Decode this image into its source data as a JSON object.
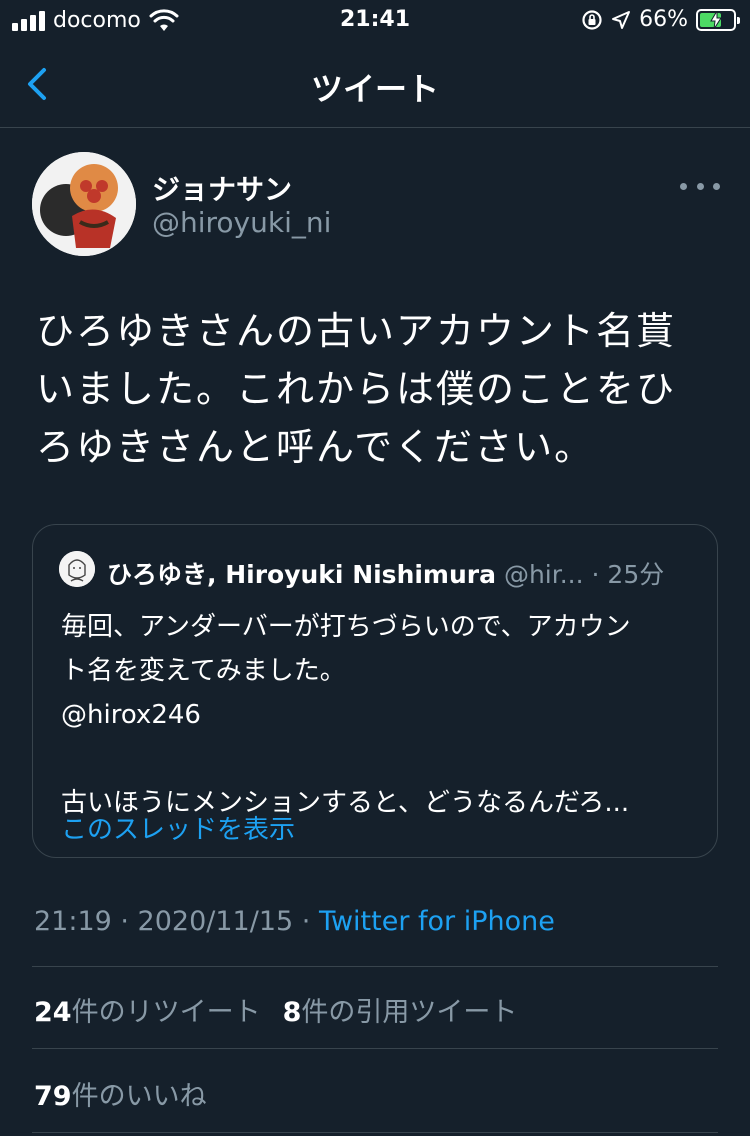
{
  "status_bar": {
    "carrier": "docomo",
    "time": "21:41",
    "battery_percent": "66%",
    "battery_level": 0.66
  },
  "nav": {
    "title": "ツイート"
  },
  "tweet": {
    "display_name": "ジョナサン",
    "handle": "@hiroyuki_ni",
    "text_lines": [
      "ひろゆきさんの古いアカウント名貰",
      "いました。これからは僕のことをひ",
      "ろゆきさんと呼んでください。"
    ],
    "timestamp": "21:19 · 2020/11/15 · ",
    "source": "Twitter for iPhone"
  },
  "quote": {
    "name": "ひろゆき, Hiroyuki Nishimura",
    "handle_truncated": "@hir...",
    "time_ago": "· 25分",
    "lines": [
      "毎回、アンダーバーが打ちづらいので、アカウン",
      "ト名を変えてみました。",
      "@hirox246",
      "",
      "古いほうにメンションすると、どうなるんだろ..."
    ],
    "thread_link": "このスレッドを表示"
  },
  "stats": {
    "retweets_count": "24",
    "retweets_label": "件のリツイート",
    "quotes_count": "8",
    "quotes_label": "件の引用ツイート",
    "likes_count": "79",
    "likes_label": "件のいいね"
  },
  "colors": {
    "background": "#15202b",
    "accent": "#1da1f2",
    "secondary_text": "#8899a6",
    "divider": "#38444d"
  }
}
